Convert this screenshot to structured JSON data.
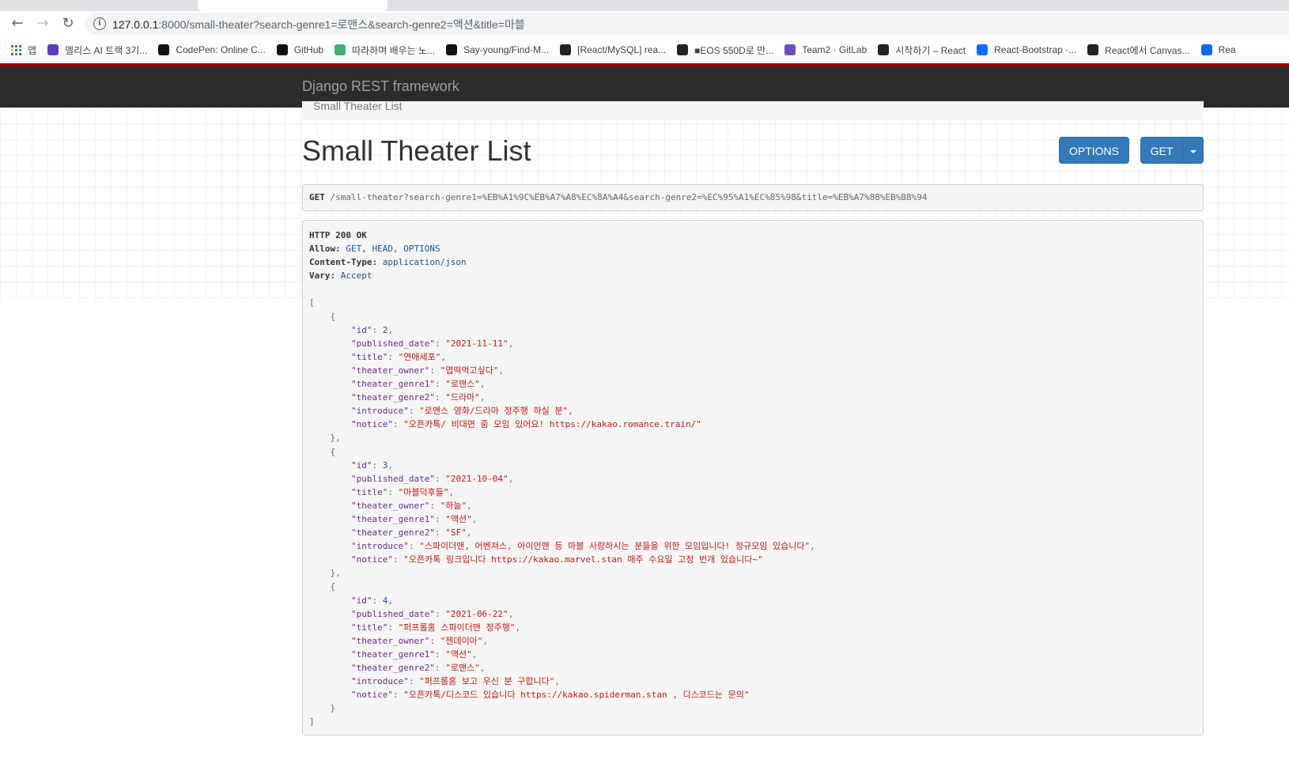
{
  "browser": {
    "url_host": "127.0.0.1",
    "url_rest": ":8000/small-theater?search-genre1=로맨스&search-genre2=액션&title=마블",
    "bookmarks": [
      {
        "label": "앱",
        "icon": "apps-grid-icon"
      },
      {
        "label": "엘리스 AI 트랙 3기...",
        "icon": "elice-icon",
        "color": "#5b3cc4"
      },
      {
        "label": "CodePen: Online C...",
        "icon": "codepen-icon",
        "color": "#111111"
      },
      {
        "label": "GitHub",
        "icon": "github-icon",
        "color": "#111111"
      },
      {
        "label": "따라하며 배우는 노...",
        "icon": "green-circle-icon",
        "color": "#3cb371"
      },
      {
        "label": "Say-young/Find-M...",
        "icon": "github-icon",
        "color": "#111111"
      },
      {
        "label": "[React/MySQL] rea...",
        "icon": "velog-icon",
        "color": "#222222"
      },
      {
        "label": "■EOS 550D로 만...",
        "icon": "velog-icon",
        "color": "#222222"
      },
      {
        "label": "Team2 · GitLab",
        "icon": "gitlab-icon",
        "color": "#6b4fbb"
      },
      {
        "label": "시작하기 – React",
        "icon": "react-icon",
        "color": "#20232a"
      },
      {
        "label": "React-Bootstrap ·...",
        "icon": "react-bootstrap-icon",
        "color": "#0d6efd"
      },
      {
        "label": "React에서 Canvas...",
        "icon": "velog-icon",
        "color": "#222222"
      },
      {
        "label": "Rea",
        "icon": "mdb-icon",
        "color": "#1266f1"
      }
    ]
  },
  "navbar": {
    "brand": "Django REST framework"
  },
  "breadcrumb": "Small Theater List",
  "page": {
    "title": "Small Theater List",
    "options_label": "OPTIONS",
    "get_label": "GET"
  },
  "request": {
    "method": "GET",
    "path": "/small-theater?search-genre1=%EB%A1%9C%EB%A7%A8%EC%8A%A4&search-genre2=%EC%95%A1%EC%85%98&title=%EB%A7%88%EB%B8%94"
  },
  "response": {
    "status": "HTTP 200 OK",
    "headers": [
      {
        "key": "Allow:",
        "value": "GET, HEAD, OPTIONS"
      },
      {
        "key": "Content-Type:",
        "value": "application/json"
      },
      {
        "key": "Vary:",
        "value": "Accept"
      }
    ],
    "items": [
      {
        "id": 2,
        "published_date": "2021-11-11",
        "title": "연애세포",
        "theater_owner": "엽떡먹고싶다",
        "theater_genre1": "로맨스",
        "theater_genre2": "드라마",
        "introduce": "로맨스 영화/드라마 정주행 하실 분",
        "notice": "오픈카톡/ 비대면 줌 모임 있어요! https://kakao.romance.train/"
      },
      {
        "id": 3,
        "published_date": "2021-10-04",
        "title": "마블덕후들",
        "theater_owner": "하늘",
        "theater_genre1": "액션",
        "theater_genre2": "SF",
        "introduce": "스파이더맨, 어벤져스, 아이언맨 등 마블 사랑하시는 분들을 위한 모임입니다! 정규모임 있습니다",
        "notice": "오픈카톡 링크입니다 https://kakao.marvel.stan 매주 수요일 고정 번개 있습니다~"
      },
      {
        "id": 4,
        "published_date": "2021-06-22",
        "title": "퍼프롬홈 스파이더맨 정주행",
        "theater_owner": "젠데이아",
        "theater_genre1": "액션",
        "theater_genre2": "로맨스",
        "introduce": "퍼프롬홈 보고 우신 분 구합니다",
        "notice": "오픈카톡/디스코드 있습니다 https://kakao.spiderman.stan , 디스코드는 문의"
      }
    ]
  }
}
